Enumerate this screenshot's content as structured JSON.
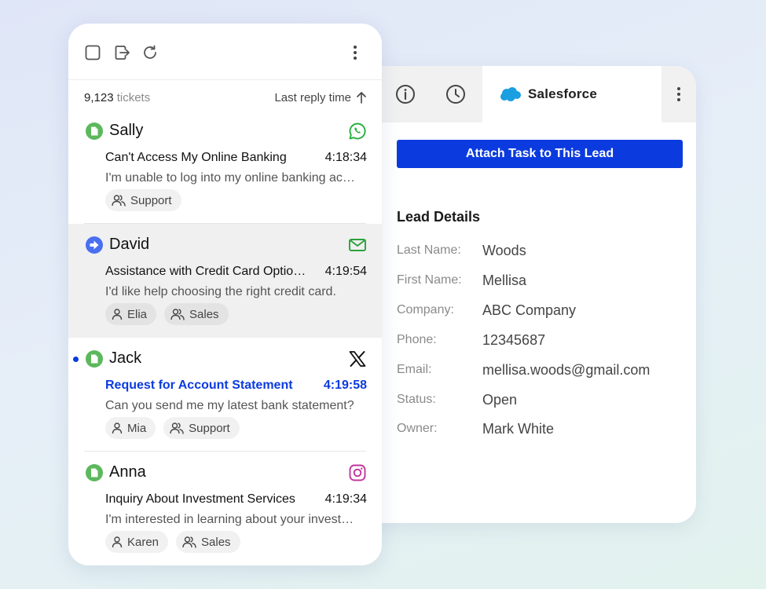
{
  "toolbar": {
    "select_all_icon": "checkbox-icon",
    "export_icon": "export-icon",
    "refresh_icon": "refresh-icon",
    "more_icon": "more-vertical-icon"
  },
  "list_header": {
    "count": "9,123",
    "count_suffix": "tickets",
    "sort_label": "Last reply time",
    "sort_icon": "arrow-up-icon"
  },
  "tickets": [
    {
      "name": "Sally",
      "status_icon": "document-icon",
      "channel_icon": "whatsapp-icon",
      "subject": "Can't Access My Online Banking",
      "time": "4:18:34",
      "preview": "I'm unable to log into my online banking ac…",
      "tags": [
        {
          "label": "Support",
          "icon": "group-icon"
        }
      ],
      "selected": false,
      "unread": false
    },
    {
      "name": "David",
      "status_icon": "arrow-right-circle-icon",
      "channel_icon": "email-icon",
      "subject": "Assistance with Credit Card Optio…",
      "time": "4:19:54",
      "preview": "I'd like help choosing the right credit card.",
      "tags": [
        {
          "label": "Elia",
          "icon": "person-icon"
        },
        {
          "label": "Sales",
          "icon": "group-icon"
        }
      ],
      "selected": true,
      "unread": false
    },
    {
      "name": "Jack",
      "status_icon": "document-icon",
      "channel_icon": "x-icon",
      "subject": "Request for Account Statement",
      "time": "4:19:58",
      "preview": "Can you send me my latest bank statement?",
      "tags": [
        {
          "label": "Mia",
          "icon": "person-icon"
        },
        {
          "label": "Support",
          "icon": "group-icon"
        }
      ],
      "selected": false,
      "unread": true
    },
    {
      "name": "Anna",
      "status_icon": "document-icon",
      "channel_icon": "instagram-icon",
      "subject": "Inquiry About Investment Services",
      "time": "4:19:34",
      "preview": "I'm interested in learning about your invest…",
      "tags": [
        {
          "label": "Karen",
          "icon": "person-icon"
        },
        {
          "label": "Sales",
          "icon": "group-icon"
        }
      ],
      "selected": false,
      "unread": false
    }
  ],
  "crm": {
    "tabs": {
      "info_icon": "info-icon",
      "history_icon": "clock-icon",
      "active_tab": "Salesforce",
      "more_icon": "more-vertical-icon"
    },
    "attach_button": "Attach Task to This Lead",
    "lead_title": "Lead Details",
    "fields": [
      {
        "label": "Last Name:",
        "value": "Woods"
      },
      {
        "label": "First Name:",
        "value": "Mellisa"
      },
      {
        "label": "Company:",
        "value": "ABC Company"
      },
      {
        "label": "Phone:",
        "value": "12345687"
      },
      {
        "label": "Email:",
        "value": "mellisa.woods@gmail.com"
      },
      {
        "label": "Status:",
        "value": "Open"
      },
      {
        "label": "Owner:",
        "value": "Mark White"
      }
    ]
  },
  "colors": {
    "accent": "#0b3bdf",
    "status_green": "#5cb85c",
    "status_blue": "#4a6ff0",
    "whatsapp": "#25b13c",
    "email": "#2aa33a",
    "instagram": "#c1359b",
    "salesforce": "#1a9fe0"
  }
}
